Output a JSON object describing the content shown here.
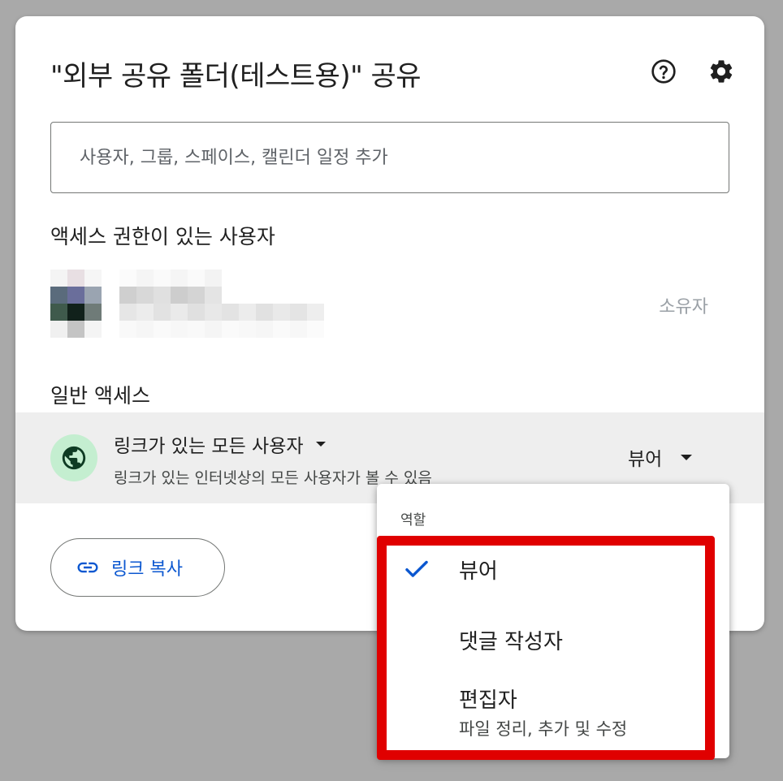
{
  "dialog": {
    "title": "\"외부 공유 폴더(테스트용)\" 공유",
    "help_icon": "help-circle-icon",
    "settings_icon": "gear-icon"
  },
  "add_people": {
    "placeholder": "사용자, 그룹, 스페이스, 캘린더 일정 추가"
  },
  "people_with_access": {
    "heading": "액세스 권한이 있는 사용자",
    "users": [
      {
        "role": "소유자"
      }
    ]
  },
  "general_access": {
    "heading": "일반 액세스",
    "icon": "globe-icon",
    "scope_label": "링크가 있는 모든 사용자",
    "description": "링크가 있는 인터넷상의 모든 사용자가 볼 수 있음",
    "role_label": "뷰어"
  },
  "copy_link": {
    "icon": "link-icon",
    "label": "링크 복사"
  },
  "role_menu": {
    "header": "역할",
    "items": [
      {
        "label": "뷰어",
        "selected": true
      },
      {
        "label": "댓글 작성자"
      },
      {
        "label": "편집자",
        "sublabel": "파일 정리, 추가 및 수정"
      }
    ]
  },
  "colors": {
    "accent": "#0b57d0",
    "highlight": "#e00000",
    "globe_bg": "#c4eed0",
    "globe_fg": "#0e3b23"
  }
}
